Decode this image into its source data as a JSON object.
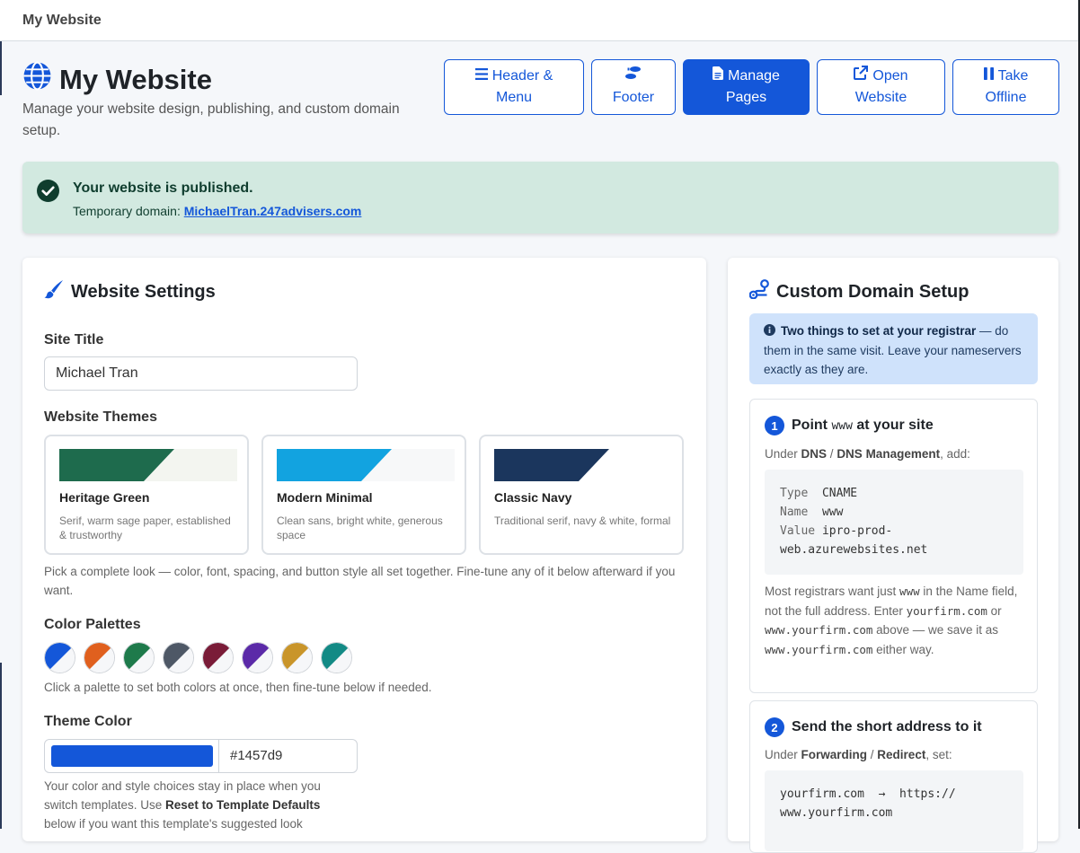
{
  "window": {
    "title": "My Website"
  },
  "header": {
    "title": "My Website",
    "subtitle": "Manage your website design, publishing, and custom domain setup.",
    "buttons": {
      "header_menu": {
        "line1": "Header &",
        "line2": "Menu"
      },
      "footer": {
        "label": "Footer"
      },
      "manage_pages": {
        "line1": "Manage",
        "line2": "Pages"
      },
      "open_website": {
        "line1": "Open",
        "line2": "Website"
      },
      "take_offline": {
        "line1": "Take",
        "line2": "Offline"
      }
    }
  },
  "banner": {
    "title": "Your website is published.",
    "domain_label": "Temporary domain:",
    "domain_link": "MichaelTran.247advisers.com"
  },
  "settings": {
    "title": "Website Settings",
    "site_title_label": "Site Title",
    "site_title_value": "Michael Tran",
    "themes_label": "Website Themes",
    "themes": [
      {
        "name": "Heritage Green",
        "desc": "Serif, warm sage paper, established & trustworthy",
        "primary": "#1e6b4d",
        "secondary": "#f3f5f0"
      },
      {
        "name": "Modern Minimal",
        "desc": "Clean sans, bright white, generous space",
        "primary": "#12a3e0",
        "secondary": "#f7f8f9"
      },
      {
        "name": "Classic Navy",
        "desc": "Traditional serif, navy & white, formal",
        "primary": "#1b365d",
        "secondary": "#ffffff"
      }
    ],
    "themes_help": "Pick a complete look — color, font, spacing, and button style all set together. Fine-tune any of it below afterward if you want.",
    "palettes_label": "Color Palettes",
    "palettes": [
      "#1457d9",
      "#e0601e",
      "#1e7a4b",
      "#4e5866",
      "#7a1c38",
      "#5b2aa8",
      "#c9952a",
      "#138a85"
    ],
    "palettes_help": "Click a palette to set both colors at once, then fine-tune below if needed.",
    "theme_color_label": "Theme Color",
    "theme_color_value": "#1457d9",
    "theme_help_1": "Your color and style choices stay in place when you switch templates. Use ",
    "theme_help_bold": "Reset to Template Defaults",
    "theme_help_2": "below if you want this template's suggested look"
  },
  "domain": {
    "title": "Custom Domain Setup",
    "info_bold": "Two things to set at your registrar",
    "info_rest": " — do them in the same visit. Leave your nameservers exactly as they are.",
    "step1": {
      "num": "1",
      "title_a": "Point ",
      "title_code": "www",
      "title_b": " at your site",
      "under_a": "Under ",
      "under_b1": "DNS",
      "under_sep": " / ",
      "under_b2": "DNS Management",
      "under_c": ", add:",
      "record": {
        "type_k": "Type",
        "type_v": "CNAME",
        "name_k": "Name",
        "name_v": "www",
        "value_k": "Value",
        "value_v1": "ipro-prod-",
        "value_v2": "web.azurewebsites.net"
      },
      "note_1": "Most registrars want just ",
      "note_code1": "www",
      "note_2": " in the Name field, not the full address. Enter ",
      "note_code2": "yourfirm.com",
      "note_3": " or ",
      "note_code3": "www.yourfirm.com",
      "note_4": " above — we save it as ",
      "note_code4": "www.yourfirm.com",
      "note_5": " either way."
    },
    "step2": {
      "num": "2",
      "title": "Send the short address to it",
      "under_a": "Under ",
      "under_b1": "Forwarding",
      "under_sep": " / ",
      "under_b2": "Redirect",
      "under_c": ", set:",
      "line1": "yourfirm.com  →  https://",
      "line2": "www.yourfirm.com"
    }
  }
}
